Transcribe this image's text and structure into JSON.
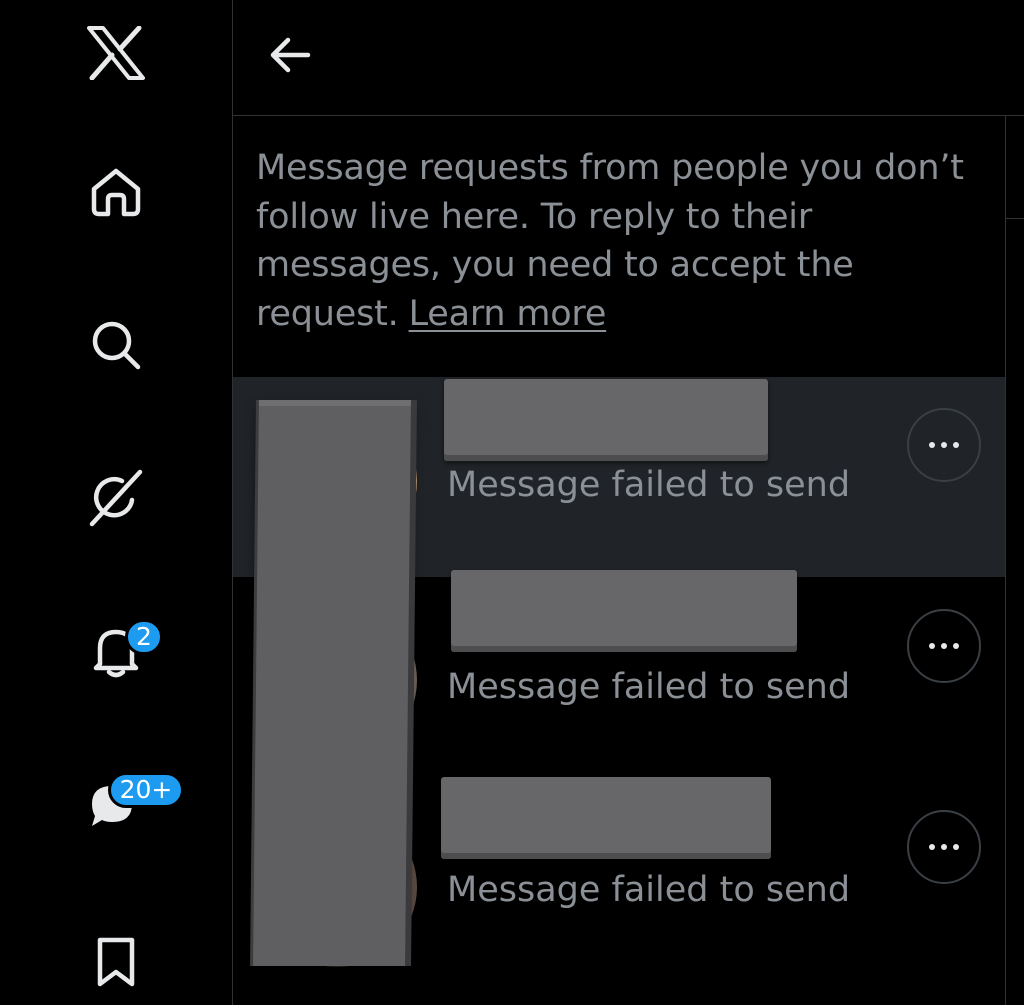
{
  "sidebar": {
    "logo_icon": "x-logo-icon",
    "items": [
      {
        "name": "home",
        "icon": "home-icon"
      },
      {
        "name": "explore",
        "icon": "search-icon"
      },
      {
        "name": "grok",
        "icon": "grok-icon"
      },
      {
        "name": "notifications",
        "icon": "bell-icon",
        "badge": "2"
      },
      {
        "name": "messages",
        "icon": "messages-icon",
        "badge": "20+"
      },
      {
        "name": "bookmarks",
        "icon": "bookmark-icon"
      }
    ]
  },
  "header": {
    "back_icon": "back-arrow-icon"
  },
  "info": {
    "text": "Message requests from people you don’t follow live here. To reply to their messages, you need to accept the request.",
    "link": "Learn more"
  },
  "requests": [
    {
      "status": "Message failed to send",
      "highlighted": true
    },
    {
      "status": "Message failed to send",
      "highlighted": false
    },
    {
      "status": "Message failed to send",
      "highlighted": false
    }
  ],
  "colors": {
    "background": "#000000",
    "highlight_row": "#202327",
    "accent": "#1d9bf0",
    "muted_text": "#8b9096"
  }
}
